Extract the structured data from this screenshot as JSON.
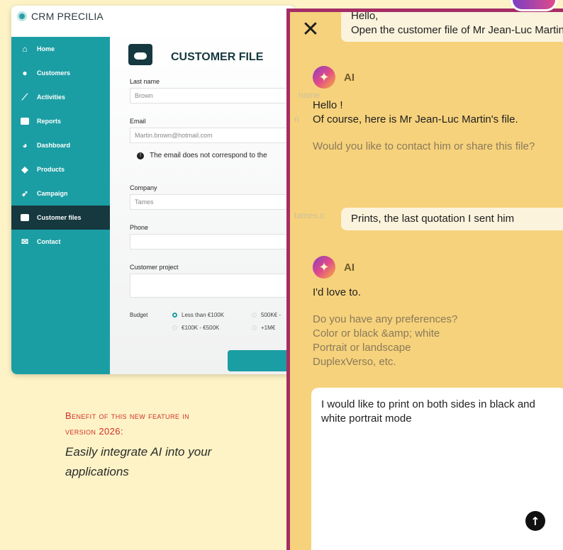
{
  "crm": {
    "app_name": "CRM PRECILIA",
    "sidebar": [
      {
        "label": "Home",
        "icon": "home-icon"
      },
      {
        "label": "Customers",
        "icon": "customers-icon"
      },
      {
        "label": "Activities",
        "icon": "activities-icon"
      },
      {
        "label": "Reports",
        "icon": "reports-icon"
      },
      {
        "label": "Dashboard",
        "icon": "dashboard-icon"
      },
      {
        "label": "Products",
        "icon": "products-icon"
      },
      {
        "label": "Campaign",
        "icon": "campaign-icon"
      },
      {
        "label": "Customer files",
        "icon": "customer-files-icon",
        "active": true
      },
      {
        "label": "Contact",
        "icon": "contact-icon"
      }
    ],
    "form": {
      "title": "CUSTOMER FILE",
      "last_name_label": "Last name",
      "last_name_value": "Brown",
      "email_label": "Email",
      "email_value": "Martin.brown@hotmail.com",
      "email_warning": "The email does not correspond to the",
      "company_label": "Company",
      "company_value": "Tames",
      "phone_label": "Phone",
      "project_label": "Customer project",
      "budget_label": "Budget",
      "budget_options": [
        "Less than €100K",
        "500K€ -",
        "€100K - €500K",
        "+1M€"
      ]
    },
    "ghost_text": [
      "name",
      "n",
      "tames.c"
    ]
  },
  "caption": {
    "heading_line1": "Benefit of this new feature in",
    "heading_line2": "version 2026:",
    "body": "Easily integrate AI into your applications"
  },
  "chat": {
    "user_msg_1_partial": "Hello,",
    "user_msg_1": "Open the customer file of Mr Jean-Luc Martin",
    "ai_name": "AI",
    "ai_reply_1_greeting": "Hello !",
    "ai_reply_1_text": "Of course, here is Mr Jean-Luc Martin's file.",
    "ai_reply_1_question": "Would you like to contact him or share this file?",
    "user_msg_2": "Prints, the last quotation I sent him",
    "ai_reply_2_text": "I'd love to.",
    "ai_reply_2_q1": "Do you have any preferences?",
    "ai_reply_2_q2": "Color or black &amp; white",
    "ai_reply_2_q3": "Portrait or landscape",
    "ai_reply_2_q4": "DuplexVerso, etc.",
    "compose_text": "I would like to print on both sides in black and white portrait mode",
    "close_label": "✕",
    "send_label": "↑"
  },
  "colors": {
    "teal": "#1b9ea3",
    "dark": "#16383f",
    "panel_border": "#a52d66",
    "panel_bg": "#f6d27c",
    "caption_red": "#d0302a"
  }
}
